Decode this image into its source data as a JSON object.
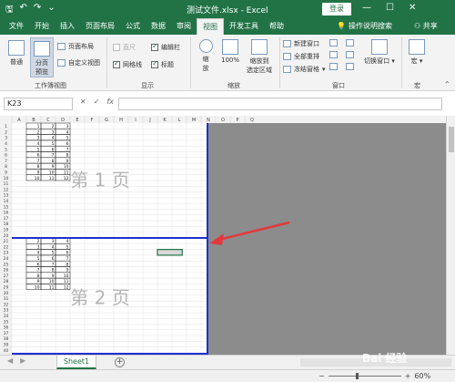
{
  "titlebar": {
    "title": "测试文件.xlsx  -  Excel",
    "login": "登录",
    "save_icon": "save-icon",
    "undo_icon": "undo-icon",
    "redo_icon": "redo-icon",
    "win_controls": [
      "—",
      "☐",
      "✕"
    ]
  },
  "tabs": [
    "文件",
    "开始",
    "插入",
    "页面布局",
    "公式",
    "数据",
    "审阅",
    "视图",
    "开发工具",
    "帮助"
  ],
  "active_tab": "视图",
  "tellme": "操作说明搜索",
  "share": "共享",
  "ribbon": {
    "workbook_views": {
      "label": "工作簿视图",
      "normal": "普通",
      "page_break": "分页\n预览",
      "page_layout": "页面布局",
      "custom_views": "自定义视图"
    },
    "show": {
      "label": "显示",
      "ruler": "直尺",
      "formula_bar": "编辑栏",
      "gridlines": "网格线",
      "headings": "标题"
    },
    "zoom": {
      "label": "缩放",
      "zoom": "缩\n放",
      "hundred": "100%",
      "to_selection": "缩放到\n选定区域"
    },
    "window": {
      "label": "窗口",
      "new_window": "新建窗口",
      "arrange_all": "全部重排",
      "freeze_panes": "冻结窗格",
      "switch_windows": "切换窗口"
    },
    "macros": {
      "label": "宏",
      "macro": "宏"
    }
  },
  "formula_bar": {
    "namebox": "K23",
    "cancel": "✕",
    "enter": "✓",
    "fx": "fx",
    "value": ""
  },
  "grid": {
    "columns": [
      "A",
      "B",
      "C",
      "D",
      "E",
      "F",
      "G",
      "H",
      "I",
      "J",
      "K",
      "L",
      "M",
      "N",
      "O",
      "P",
      "Q"
    ],
    "row_count": 40,
    "selected_cell": "K23",
    "page_labels": [
      "第 1 页",
      "第 2 页"
    ],
    "page1_rows": [
      [
        1,
        2,
        3
      ],
      [
        2,
        3,
        4
      ],
      [
        3,
        4,
        5
      ],
      [
        4,
        5,
        6
      ],
      [
        5,
        6,
        7
      ],
      [
        6,
        7,
        8
      ],
      [
        7,
        8,
        9
      ],
      [
        8,
        9,
        10
      ],
      [
        9,
        10,
        11
      ],
      [
        10,
        11,
        12
      ]
    ],
    "page2_rows": [
      [
        2,
        3,
        4
      ],
      [
        3,
        4,
        5
      ],
      [
        4,
        5,
        6
      ],
      [
        5,
        6,
        7
      ],
      [
        6,
        7,
        8
      ],
      [
        7,
        8,
        9
      ],
      [
        8,
        9,
        10
      ],
      [
        9,
        10,
        11
      ],
      [
        10,
        11,
        12
      ]
    ]
  },
  "sheets": [
    "Sheet1"
  ],
  "add_sheet": "+",
  "zoom_level": "60%",
  "zoom_minus": "−",
  "zoom_plus": "+",
  "watermark": "Bai 经验",
  "colors": {
    "brand": "#217346",
    "page_break": "#1f2fd1",
    "arrow": "#e4393c",
    "grey_area": "#8c8c8c"
  }
}
